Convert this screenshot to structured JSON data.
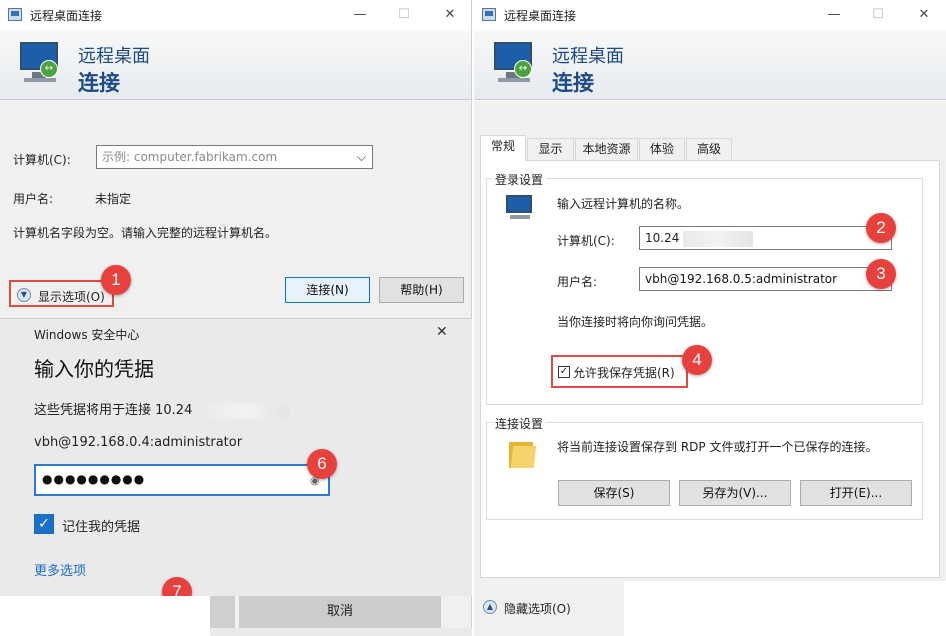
{
  "left_window": {
    "title": "远程桌面连接",
    "controls": [
      "—",
      "☐",
      "✕"
    ],
    "header_line1": "远程桌面",
    "header_line2": "连接",
    "computer_label": "计算机(C):",
    "computer_placeholder": "示例: computer.fabrikam.com",
    "username_label": "用户名:",
    "username_value": "未指定",
    "info_text": "计算机名字段为空。请输入完整的远程计算机名。",
    "show_options": "显示选项(O)",
    "connect_button": "连接(N)",
    "help_button": "帮助(H)"
  },
  "security_dialog": {
    "title": "Windows 安全中心",
    "close": "✕",
    "heading": "输入你的凭据",
    "desc": "这些凭据将用于连接 10.24",
    "account": "vbh@192.168.0.4:administrator",
    "password_value": "●●●●●●●●●",
    "remember": "记住我的凭据",
    "more_options": "更多选项",
    "cancel_button": "取消"
  },
  "right_window": {
    "title": "远程桌面连接",
    "controls": [
      "—",
      "☐",
      "✕"
    ],
    "header_line1": "远程桌面",
    "header_line2": "连接",
    "tabs": [
      "常规",
      "显示",
      "本地资源",
      "体验",
      "高级"
    ],
    "login_group": "登录设置",
    "login_desc": "输入远程计算机的名称。",
    "computer_label": "计算机(C):",
    "computer_value": "10.24",
    "username_label": "用户名:",
    "username_value": "vbh@192.168.0.5:administrator",
    "prompt_text": "当你连接时将向你询问凭据。",
    "allow_save": "允许我保存凭据(R)",
    "conn_group": "连接设置",
    "conn_desc": "将当前连接设置保存到 RDP 文件或打开一个已保存的连接。",
    "save_button": "保存(S)",
    "save_as_button": "另存为(V)...",
    "open_button": "打开(E)...",
    "hide_options": "隐藏选项(O)"
  },
  "markers": [
    "1",
    "2",
    "3",
    "4",
    "6",
    "7"
  ],
  "colors": {
    "marker": "#e8403d",
    "accent": "#1c4a86",
    "checkbox": "#1a6fc9",
    "link": "#1a6fc9"
  }
}
